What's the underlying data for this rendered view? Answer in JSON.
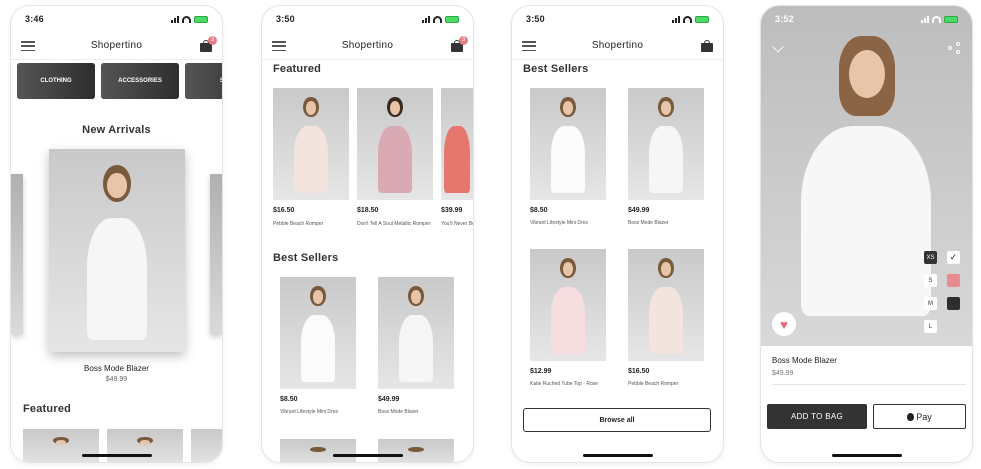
{
  "app": {
    "title": "Shopertino"
  },
  "screen1": {
    "time": "3:46",
    "cart_count": "3",
    "categories": [
      "CLOTHING",
      "ACCESSORIES",
      "SH"
    ],
    "new_arrivals_title": "New Arrivals",
    "hero": {
      "name": "Boss Mode Blazer",
      "price": "$49.99"
    },
    "featured_title": "Featured"
  },
  "screen2": {
    "time": "3:50",
    "cart_count": "3",
    "featured_title": "Featured",
    "featured": [
      {
        "price": "$16.50",
        "name": "Pebble Beach Romper"
      },
      {
        "price": "$18.50",
        "name": "Don't Tell A Soul Metallic Romper"
      },
      {
        "price": "$39.99",
        "name": "You'll Never Be..."
      }
    ],
    "best_sellers_title": "Best Sellers",
    "best_sellers": [
      {
        "price": "$8.50",
        "name": "Vibrant Lifestyle Mini Dres"
      },
      {
        "price": "$49.99",
        "name": "Boss Mode Blazer"
      }
    ]
  },
  "screen3": {
    "time": "3:50",
    "best_sellers_title": "Best Sellers",
    "products": [
      {
        "price": "$8.50",
        "name": "Vibrant Lifestyle Mini Dres"
      },
      {
        "price": "$49.99",
        "name": "Boss Mode Blazer"
      },
      {
        "price": "$12.99",
        "name": "Katie Ruched Tube Top - Rose"
      },
      {
        "price": "$16.50",
        "name": "Pebble Beach Romper"
      }
    ],
    "browse_all": "Browse all"
  },
  "screen4": {
    "time": "3:52",
    "sizes": [
      "XS",
      "S",
      "M",
      "L"
    ],
    "selected_size": "XS",
    "product_name": "Boss Mode Blazer",
    "product_price": "$49.99",
    "add_to_bag": "ADD TO BAG",
    "pay_label": "Pay",
    "colors": {
      "pink": "#e88a8f",
      "dark": "#2e2e2e",
      "white": "#ffffff"
    }
  },
  "colors": {
    "cart_badge": "#e87a86",
    "heart": "#e06a7b",
    "dark_button": "#333333"
  },
  "icons": [
    "hamburger-icon",
    "bag-icon",
    "heart-icon",
    "share-icon",
    "chevron-down-icon",
    "apple-icon",
    "checkmark-icon"
  ]
}
